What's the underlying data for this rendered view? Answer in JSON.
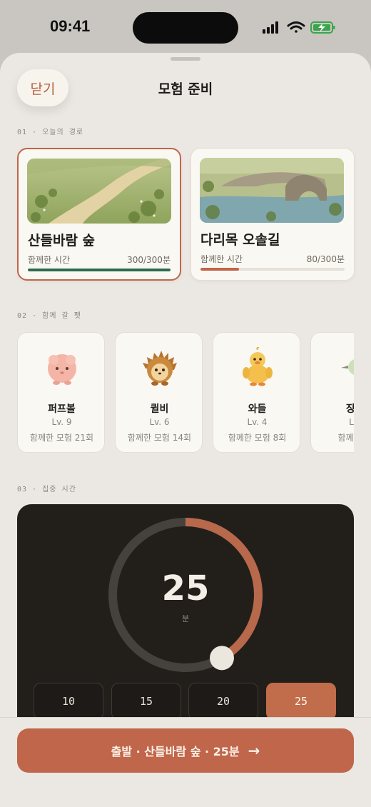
{
  "status_bar": {
    "time": "09:41"
  },
  "header": {
    "close_label": "닫기",
    "title": "모험 준비"
  },
  "sections": {
    "route_label": "01 · 오늘의 경로",
    "pet_label": "02 · 함께 갈 펫",
    "timer_label": "03 · 집중 시간"
  },
  "routes": [
    {
      "name": "산들바람 숲",
      "time_label": "함께한 시간",
      "time_value": "300/300분",
      "progress": 1.0,
      "bar_color": "#2e6b4f",
      "selected": true
    },
    {
      "name": "다리목 오솔길",
      "time_label": "함께한 시간",
      "time_value": "80/300분",
      "progress": 0.267,
      "bar_color": "#c0664a",
      "selected": false
    }
  ],
  "pets": [
    {
      "name": "퍼프볼",
      "level": "Lv. 9",
      "adventures": "함께한 모험 21회",
      "icon": "pink-puffball-icon"
    },
    {
      "name": "퀼비",
      "level": "Lv. 6",
      "adventures": "함께한 모험 14회",
      "icon": "hedgehog-icon"
    },
    {
      "name": "와들",
      "level": "Lv. 4",
      "adventures": "함께한 모험 8회",
      "icon": "duckling-icon"
    },
    {
      "name": "징글",
      "level": "Lv.",
      "adventures": "함께한 모",
      "icon": "bird-icon"
    }
  ],
  "timer": {
    "value": "25",
    "unit": "분",
    "progress": 0.4167,
    "presets": [
      "10",
      "15",
      "20",
      "25"
    ],
    "selected_preset": "25"
  },
  "cta": {
    "label": "출발 · 산들바람 숲 · 25분",
    "arrow": "→"
  },
  "colors": {
    "accent": "#c0664a",
    "panel": "#221f1b",
    "sheet": "#ebe8e3",
    "forest_green": "#2e6b4f"
  }
}
